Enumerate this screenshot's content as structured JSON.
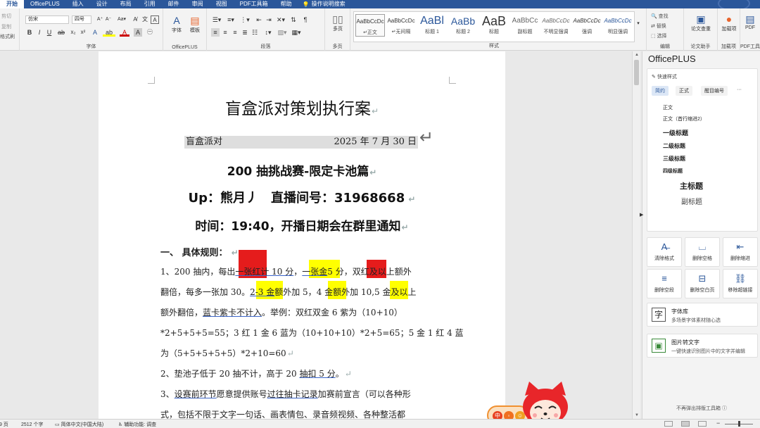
{
  "menubar": {
    "tabs": [
      "开始",
      "OfficePLUS",
      "插入",
      "设计",
      "布局",
      "引用",
      "邮件",
      "审阅",
      "视图",
      "PDF工具箱",
      "帮助"
    ],
    "search_label": "操作说明搜索"
  },
  "ribbon": {
    "clipboard": {
      "cut": "剪切",
      "copy": "复制",
      "painter": "格式刷"
    },
    "font": {
      "name": "仿宋",
      "size": "四号",
      "label": "字体"
    },
    "officeplus": {
      "font_btn": "字体",
      "template_btn": "模板",
      "label": "OfficePLUS"
    },
    "paragraph": {
      "label": "段落"
    },
    "pages": {
      "multipage": "多页",
      "label": "多页"
    },
    "styles": {
      "label": "样式",
      "items": [
        {
          "sample": "AaBbCcDc",
          "name": "↵正文"
        },
        {
          "sample": "AaBbCcDc",
          "name": "↵无间隔"
        },
        {
          "sample": "AaBl",
          "name": "标题 1"
        },
        {
          "sample": "AaBb",
          "name": "标题 2"
        },
        {
          "sample": "AaB",
          "name": "标题"
        },
        {
          "sample": "AaBbCc",
          "name": "副标题"
        },
        {
          "sample": "AaBbCcDc",
          "name": "不明显强调"
        },
        {
          "sample": "AaBbCcDc",
          "name": "强调"
        },
        {
          "sample": "AaBbCcDc",
          "name": "明显强调"
        }
      ]
    },
    "editing": {
      "find": "查找",
      "replace": "替换",
      "select": "选择",
      "label": "编辑"
    },
    "essay": {
      "btn": "论文查重",
      "label": "论文助手"
    },
    "addin": {
      "btn": "加载项",
      "label": "加载项"
    },
    "pdf": {
      "btn": "PDF",
      "label": "PDF工具"
    }
  },
  "document": {
    "title": "盲盒派对策划执行案",
    "meta_left": "盲盒派对",
    "meta_right": "2025 年 7 月 30 日",
    "subtitle": "200 抽挑战赛-限定卡池篇",
    "host_line": "Up：熊月丿　直播间号：31968668",
    "time_line": "时间：19:40，开播日期会在群里通知",
    "section_head": "一、 具体规则：",
    "line1": {
      "a": "1、200 抽内，每出",
      "b": "一张红计 10 分",
      "c": "，",
      "d": "一张金",
      "e": "5 分，",
      "f": "双红",
      "g": "及以上额外"
    },
    "line2": {
      "a": "翻倍，每多一张加 30。",
      "b": "2-3 金",
      "c": "额外加 5，",
      "d": "4 金",
      "e": "额外加 10,",
      "f": "5 金",
      "g": "及以上"
    },
    "line3": {
      "a": "额外翻倍，",
      "b": "蓝卡紫卡不计入",
      "c": "。举例：双红双金 6 紫为（10+10）"
    },
    "line4": "*2+5+5+5=55；3 红 1 金 6 蓝为（10+10+10）*2+5=65；5 金 1 红 4 蓝",
    "line5": "为（5+5+5+5+5）*2+10=60",
    "line6": {
      "a": "2、垫池子低于 20 抽不计，高于 20 ",
      "b": "抽扣 5 分",
      "c": "。"
    },
    "line7": {
      "a": "3、",
      "b": "设赛前环节",
      "c": "愿意提供账号",
      "d": "过往抽卡记录",
      "e": "加赛前宣言（可以各种形"
    },
    "line8": "式，包括不限于文字一句话、画表情包、录音频视频、各种整活都"
  },
  "pane": {
    "title": "OfficePLUS",
    "quick_styles": "快速样式",
    "tabs": [
      "简约",
      "正式",
      "醒目编号",
      "···"
    ],
    "styles": [
      "正文",
      "正文（首行缩进2）",
      "一级标题",
      "二级标题",
      "三级标题",
      "四级标题",
      "主标题",
      "副标题"
    ],
    "tools": [
      "清除格式",
      "删除空格",
      "删除缩进",
      "删除空段",
      "删除空白页",
      "移除超链接"
    ],
    "font_lib": {
      "title": "字体库",
      "desc": "多场景字体素材随心选"
    },
    "ocr": {
      "title": "图片转文字",
      "desc": "一键快速识别图片中的文字并编辑"
    },
    "footer": "不再弹出排版工具箱"
  },
  "status": {
    "page": "共 9 页",
    "words": "2512 个字",
    "lang": "简体中文(中国大陆)",
    "accessibility": "辅助功能: 调查"
  }
}
